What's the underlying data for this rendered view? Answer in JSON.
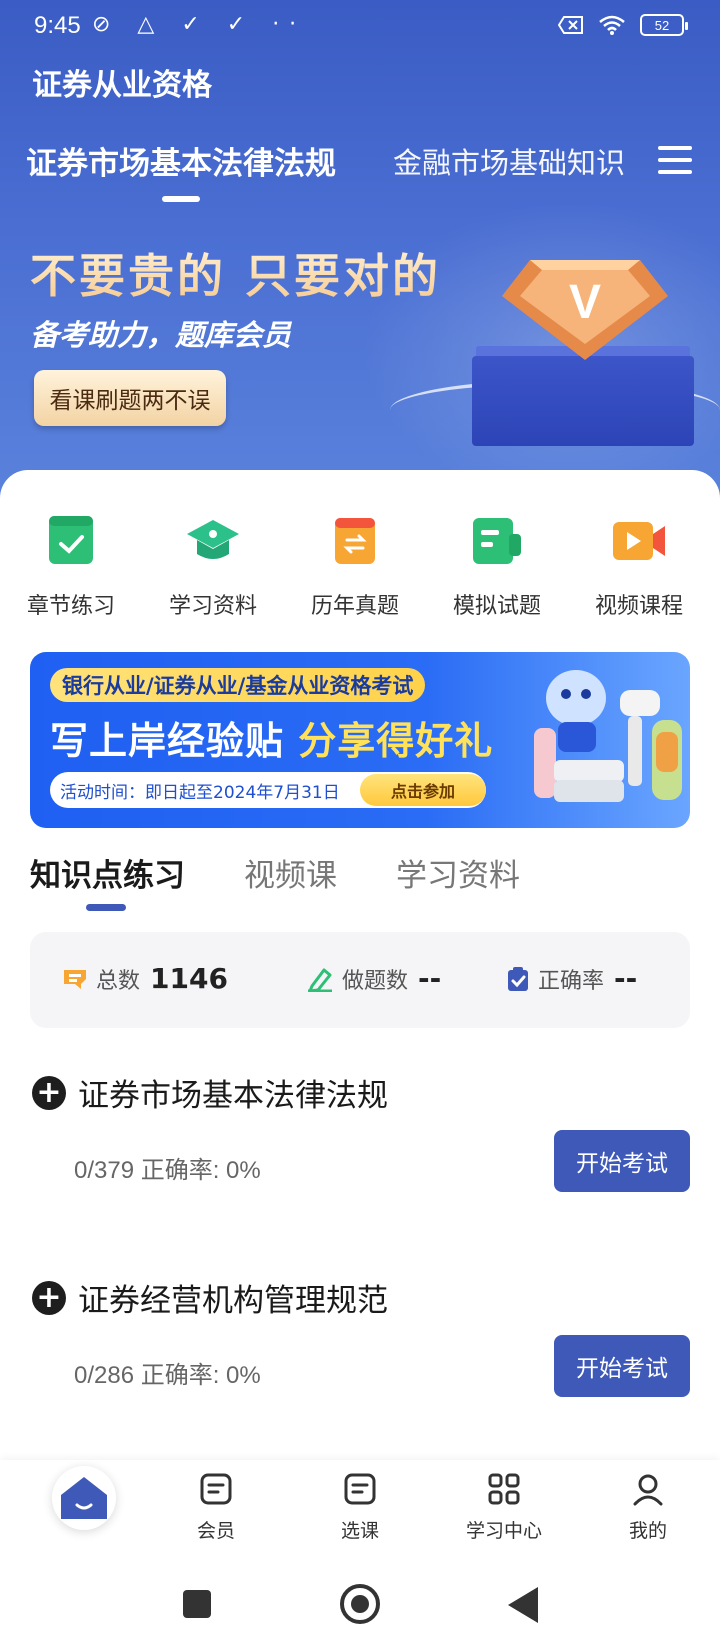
{
  "status_bar": {
    "time": "9:45",
    "left_icons": "⊘ △ ✓ ✓ ··",
    "battery": "52"
  },
  "header": {
    "app_title": "证券从业资格",
    "tabs": [
      {
        "label": "证券市场基本法律法规",
        "active": true
      },
      {
        "label": "金融市场基础知识",
        "active": false
      }
    ],
    "menu_icon": "hamburger-icon"
  },
  "banner": {
    "slogan": "不要贵的 只要对的",
    "subtitle": "备考助力，题库会员",
    "cta": "看课刷题两不误",
    "badge_letter": "V"
  },
  "quick_actions": [
    {
      "label": "章节练习",
      "icon": "chapter-practice-icon",
      "color": "#2dbf76"
    },
    {
      "label": "学习资料",
      "icon": "graduation-cap-icon",
      "color": "#2cc08a"
    },
    {
      "label": "历年真题",
      "icon": "exam-book-icon",
      "color": "#f7a634"
    },
    {
      "label": "模拟试题",
      "icon": "mock-test-icon",
      "color": "#2dbf76"
    },
    {
      "label": "视频课程",
      "icon": "video-icon",
      "color": "#f7a634"
    }
  ],
  "promo": {
    "tag": "银行从业/证券从业/基金从业资格考试",
    "headline_part1": "写上岸经验贴 ",
    "headline_part2": "分享得好礼",
    "time": "活动时间：即日起至2024年7月31日",
    "join": "点击参加"
  },
  "sub_tabs": [
    {
      "label": "知识点练习",
      "active": true
    },
    {
      "label": "视频课",
      "active": false
    },
    {
      "label": "学习资料",
      "active": false
    }
  ],
  "stats": {
    "total_label": "总数",
    "total_value": "1146",
    "done_label": "做题数",
    "done_value": "--",
    "accuracy_label": "正确率",
    "accuracy_value": "--"
  },
  "sections": [
    {
      "title": "证券市场基本法律法规",
      "progress": "0/379  正确率: 0%",
      "button": "开始考试"
    },
    {
      "title": "证券经营机构管理规范",
      "progress": "0/286  正确率: 0%",
      "button": "开始考试"
    }
  ],
  "bottom_nav": [
    {
      "label": "",
      "icon": "home-icon"
    },
    {
      "label": "会员",
      "icon": "member-icon"
    },
    {
      "label": "选课",
      "icon": "course-select-icon"
    },
    {
      "label": "学习中心",
      "icon": "grid-icon"
    },
    {
      "label": "我的",
      "icon": "profile-icon"
    }
  ],
  "colors": {
    "primary": "#3f59b8",
    "hero_blue": "#4a6ed2",
    "green": "#2dbf76",
    "orange": "#f7a634"
  }
}
